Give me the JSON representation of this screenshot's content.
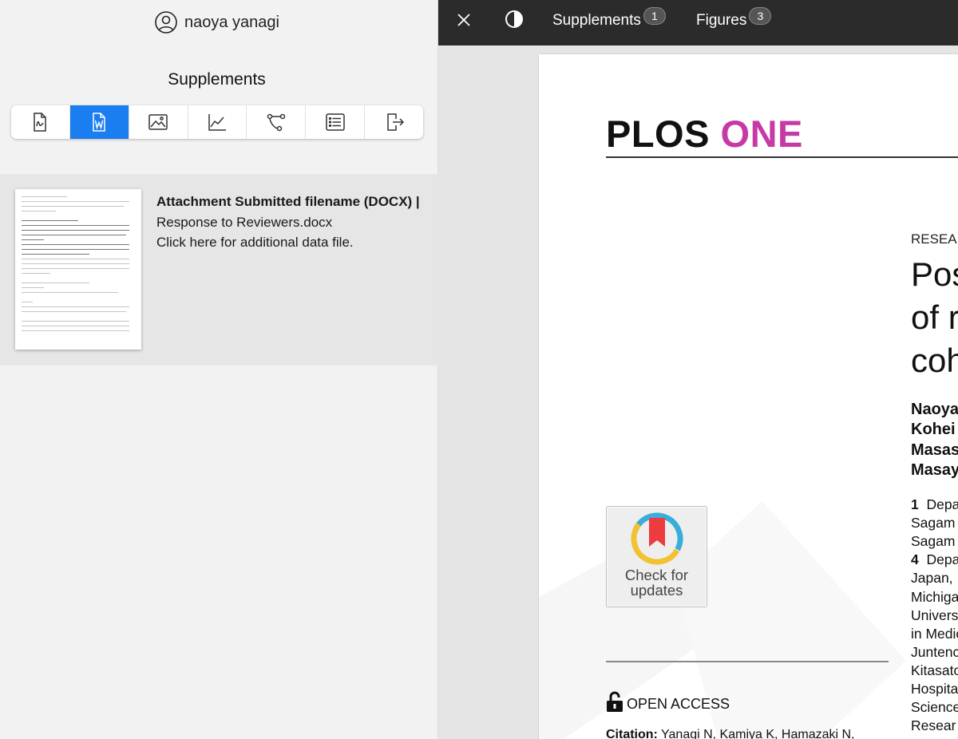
{
  "user": {
    "name": "naoya yanagi"
  },
  "supplements_panel": {
    "title": "Supplements",
    "toolbar": [
      {
        "name": "pdf-document-icon",
        "active": false
      },
      {
        "name": "word-document-icon",
        "active": true
      },
      {
        "name": "image-icon",
        "active": false
      },
      {
        "name": "chart-icon",
        "active": false
      },
      {
        "name": "workflow-icon",
        "active": false
      },
      {
        "name": "list-icon",
        "active": false
      },
      {
        "name": "export-icon",
        "active": false
      }
    ],
    "file": {
      "label_bold": "Attachment Submitted filename (DOCX) |",
      "filename": "Response to Reviewers.docx",
      "note": "Click here for additional data file."
    }
  },
  "viewer": {
    "tabs": [
      {
        "label": "Supplements",
        "count": "1"
      },
      {
        "label": "Figures",
        "count": "3"
      }
    ],
    "paper": {
      "logo_plos": "PLOS",
      "logo_one": "ONE",
      "section": "RESEA",
      "title_lines": [
        "Pos",
        "of r",
        "coh"
      ],
      "authors": [
        "Naoya",
        "Kohei",
        "Masas",
        "Masay"
      ],
      "affiliations": [
        {
          "num": "1",
          "text": "Depa"
        },
        {
          "num": "",
          "text": "Sagam"
        },
        {
          "num": "",
          "text": "Sagam"
        },
        {
          "num": "4",
          "text": "Depa"
        },
        {
          "num": "",
          "text": "Japan,"
        },
        {
          "num": "",
          "text": "Michiga"
        },
        {
          "num": "",
          "text": "Univers"
        },
        {
          "num": "",
          "text": "in Medic"
        },
        {
          "num": "",
          "text": "Juntenc"
        },
        {
          "num": "",
          "text": "Kitasato"
        },
        {
          "num": "",
          "text": "Hospita"
        },
        {
          "num": "",
          "text": "Science"
        },
        {
          "num": "",
          "text": "Resear"
        }
      ],
      "check_updates_line1": "Check for",
      "check_updates_line2": "updates",
      "open_access": "OPEN ACCESS",
      "citation_label": "Citation:",
      "citation_text": "Yanagi N, Kamiya K, Hamazaki N,"
    }
  },
  "colors": {
    "accent_blue": "#1a7df0",
    "plos_one_magenta": "#c63aa6",
    "topbar": "#2b2b2b"
  }
}
